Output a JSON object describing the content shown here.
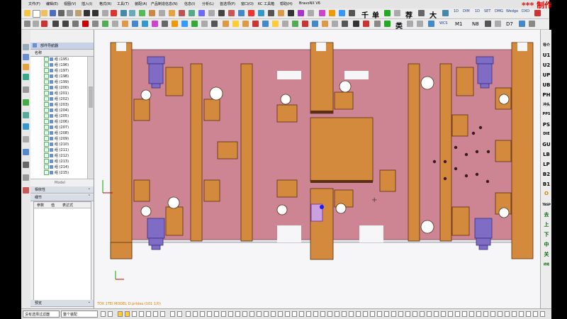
{
  "menubar": {
    "items": [
      "文件(F)",
      "编辑(E)",
      "视图(V)",
      "插入(I)",
      "格式(R)",
      "工具(T)",
      "装配(A)",
      "产品制造信息(N)",
      "信息(I)",
      "分析(L)",
      "首选项(P)",
      "窗口(O)",
      "KC 工具箱",
      "帮助(H)",
      "BravoNX V6"
    ],
    "brand": "*** 制作"
  },
  "toolbar": {
    "labels": [
      "1D",
      "DIM",
      "1D",
      "SET",
      "DMG",
      "Wedge",
      "DXO",
      "WCS",
      "M1",
      "N8",
      "D7"
    ],
    "big_glyphs": [
      "千",
      "单",
      "荐",
      "大",
      "类"
    ]
  },
  "nav": {
    "title": "部件导航器",
    "col_header": "名称",
    "items": [
      "组 (195)",
      "组 (196)",
      "组 (197)",
      "组 (198)",
      "组 (199)",
      "组 (200)",
      "组 (201)",
      "组 (202)",
      "组 (203)",
      "组 (204)",
      "组 (205)",
      "组 (206)",
      "组 (207)",
      "组 (208)",
      "组 (209)",
      "组 (210)",
      "组 (211)",
      "组 (212)",
      "组 (213)",
      "组 (214)",
      "组 (215)"
    ],
    "tree_footer": "Model",
    "section_deps": "相依性",
    "section_detail": "细节",
    "detail_cols": [
      "参数",
      "值",
      "表达式"
    ],
    "section_preview": "预览"
  },
  "viewport": {
    "footer_text": "TOX 1TEI MODEL D.prtdes (101 1/0)",
    "cursor_marker": "+"
  },
  "rightbar": {
    "labels": [
      "导介",
      "U1",
      "U2",
      "UP",
      "UB",
      "PH",
      "冲头",
      "PPS",
      "PS",
      "DIE",
      "GU",
      "LB",
      "LP",
      "B2",
      "B1",
      "O",
      "TBSP",
      "去",
      "上",
      "下",
      "中",
      "关",
      "终结"
    ]
  },
  "status": {
    "filter_text": "没有选择过滤器",
    "assembly_text": "整个装配"
  },
  "colors": {
    "plate": "#cd8594",
    "block": "#d48a3c",
    "bar_dark": "#5a2e10",
    "clamp": "#7e6cc5",
    "accent_red": "#e00000"
  }
}
